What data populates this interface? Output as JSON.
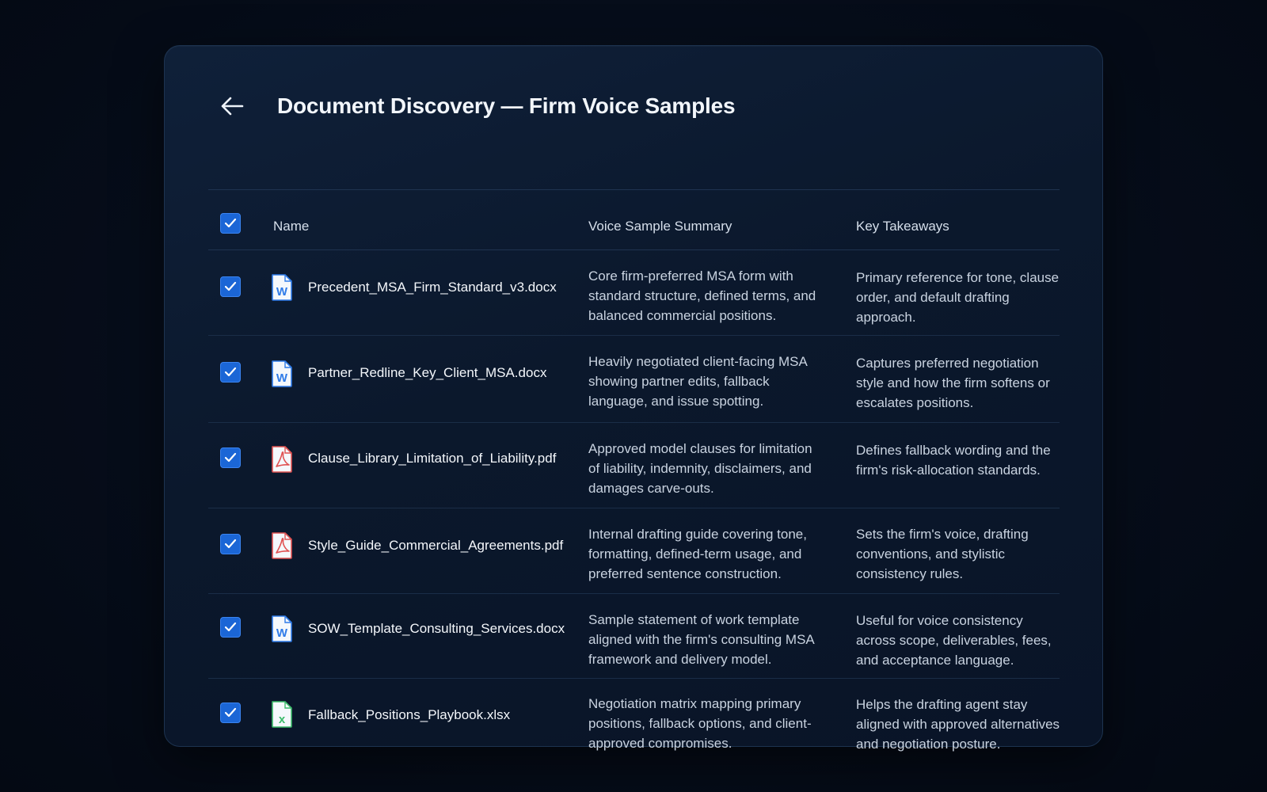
{
  "header": {
    "title": "Document Discovery — Firm Voice Samples"
  },
  "table": {
    "columns": {
      "name": "Name",
      "summary": "Voice Sample Summary",
      "takeaways": "Key Takeaways"
    },
    "rows": [
      {
        "checked": true,
        "type": "word",
        "name": "Precedent_MSA_Firm_Standard_v3.docx",
        "summary": "Core firm-preferred MSA form with standard structure, defined terms, and balanced commercial positions.",
        "takeaway": "Primary reference for tone, clause order, and default drafting approach."
      },
      {
        "checked": true,
        "type": "word",
        "name": "Partner_Redline_Key_Client_MSA.docx",
        "summary": "Heavily negotiated client-facing MSA showing partner edits, fallback language, and issue spotting.",
        "takeaway": "Captures preferred negotiation style and how the firm softens or escalates positions."
      },
      {
        "checked": true,
        "type": "pdf",
        "name": "Clause_Library_Limitation_of_Liability.pdf",
        "summary": "Approved model clauses for limitation of liability, indemnity, disclaimers, and damages carve-outs.",
        "takeaway": "Defines fallback wording and the firm's risk-allocation standards."
      },
      {
        "checked": true,
        "type": "pdf",
        "name": "Style_Guide_Commercial_Agreements.pdf",
        "summary": "Internal drafting guide covering tone, formatting, defined-term usage, and preferred sentence construction.",
        "takeaway": "Sets the firm's voice, drafting conventions, and stylistic consistency rules."
      },
      {
        "checked": true,
        "type": "word",
        "name": "SOW_Template_Consulting_Services.docx",
        "summary": "Sample statement of work template aligned with the firm's consulting MSA framework and delivery model.",
        "takeaway": "Useful for voice consistency across scope, deliverables, fees, and acceptance language."
      },
      {
        "checked": true,
        "type": "excel",
        "name": "Fallback_Positions_Playbook.xlsx",
        "summary": "Negotiation matrix mapping primary positions, fallback options, and client-approved compromises.",
        "takeaway": "Helps the drafting agent stay aligned with approved alternatives and negotiation posture."
      }
    ]
  },
  "icons": {
    "back": "arrow-left-icon",
    "word": "word-doc-icon",
    "pdf": "pdf-doc-icon",
    "excel": "excel-doc-icon",
    "check": "checkmark-icon"
  },
  "colors": {
    "word": "#2f7be8",
    "pdf": "#e05252",
    "excel": "#3dbb6b",
    "checkbox": "#1b66d6"
  }
}
